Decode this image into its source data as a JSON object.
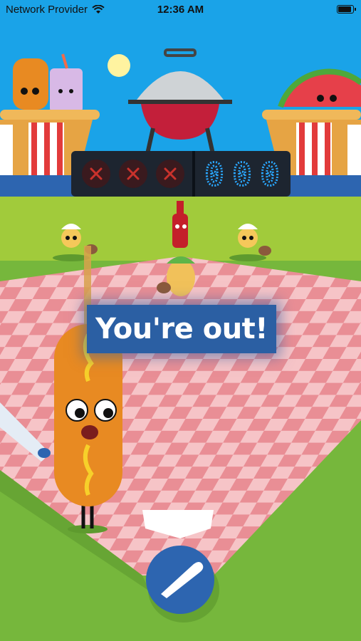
{
  "status_bar": {
    "carrier": "Network Provider",
    "time": "12:36 AM",
    "wifi_icon": "wifi-icon",
    "battery_icon": "battery-icon"
  },
  "scoreboard": {
    "strikes_total": 3,
    "strikes_filled": 3,
    "strike_icon": "x-icon",
    "score_digits": "000"
  },
  "message": {
    "text": "You're out!"
  },
  "swing_button": {
    "icon": "bat-icon"
  },
  "colors": {
    "sky": "#1aa3e8",
    "grass": "#74b83a",
    "field_pink": "#f3b3b7",
    "banner": "#2b5fa3",
    "scoreboard_bg": "#1d2530",
    "digit_blue": "#2aa8ff",
    "strike_red": "#c9322c"
  }
}
